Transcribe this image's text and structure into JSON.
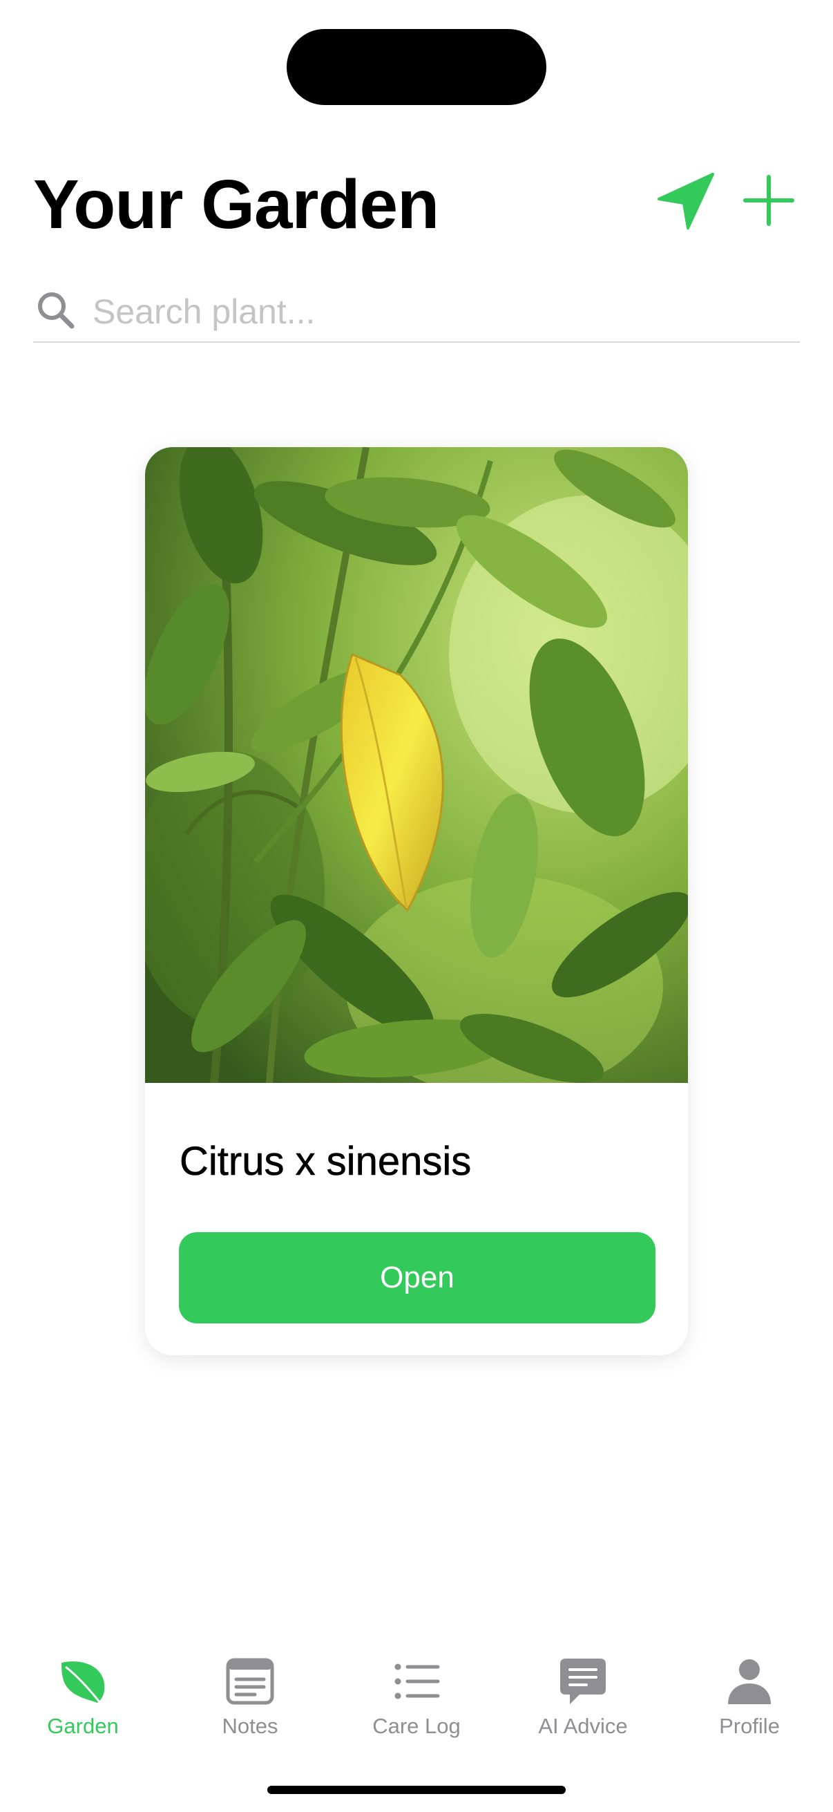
{
  "header": {
    "title": "Your Garden",
    "locate_icon": "location-arrow-icon",
    "add_icon": "plus-icon"
  },
  "search": {
    "placeholder": "Search plant...",
    "value": "",
    "icon": "search-icon"
  },
  "plants": [
    {
      "name": "Citrus x sinensis",
      "photo": "citrus leaves with one yellow leaf",
      "open_label": "Open"
    }
  ],
  "tabbar": {
    "active": "Garden",
    "tabs": [
      {
        "label": "Garden",
        "icon": "leaf-icon"
      },
      {
        "label": "Notes",
        "icon": "note-icon"
      },
      {
        "label": "Care Log",
        "icon": "list-icon"
      },
      {
        "label": "AI Advice",
        "icon": "chat-bubble-icon"
      },
      {
        "label": "Profile",
        "icon": "person-icon"
      }
    ]
  },
  "colors": {
    "accent": "#34c95b",
    "inactive": "#8e8e93",
    "text": "#000000",
    "placeholder": "#c4c4c6"
  }
}
